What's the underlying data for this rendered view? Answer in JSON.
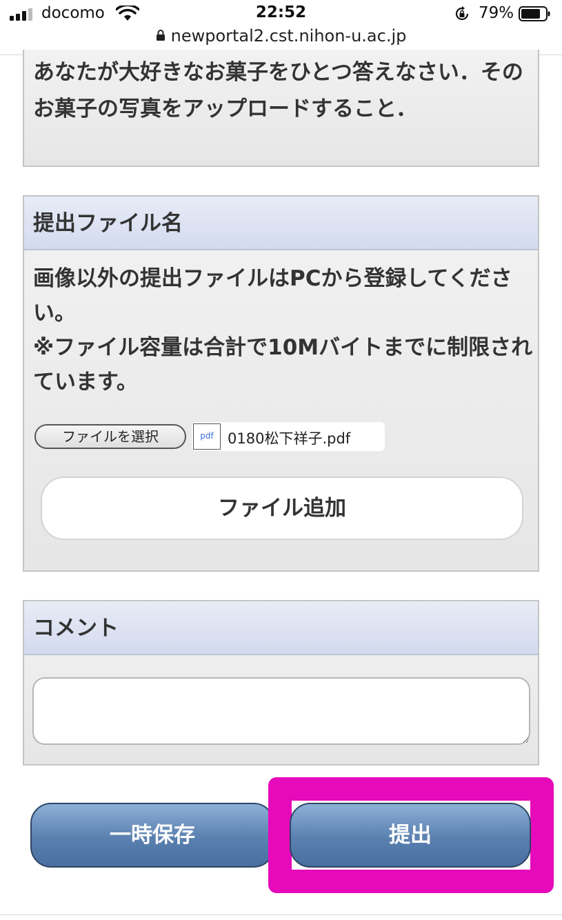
{
  "status_bar": {
    "carrier": "docomo",
    "time": "22:52",
    "battery_percent": "79%",
    "battery_level": 0.79,
    "icons": [
      "signal-icon",
      "wifi-icon",
      "rotation-lock-icon",
      "battery-icon"
    ]
  },
  "browser": {
    "url": "newportal2.cst.nihon-u.ac.jp"
  },
  "question": {
    "text": "あなたが大好きなお菓子をひとつ答えなさい．そのお菓子の写真をアップロードすること．"
  },
  "file_section": {
    "header": "提出ファイル名",
    "note_line1": "画像以外の提出ファイルはPCから登録してください。",
    "note_line2": "※ファイル容量は合計で10Mバイトまでに制限されています。",
    "choose_file_label": "ファイルを選択",
    "file_type_badge": "pdf",
    "selected_file": "0180松下祥子.pdf",
    "add_file_label": "ファイル追加"
  },
  "comment_section": {
    "header": "コメント",
    "value": ""
  },
  "actions": {
    "save_label": "一時保存",
    "submit_label": "提出"
  },
  "colors": {
    "highlight": "#e60aba",
    "button_blue": "#5a80b0",
    "panel_header": "#d4daef"
  }
}
